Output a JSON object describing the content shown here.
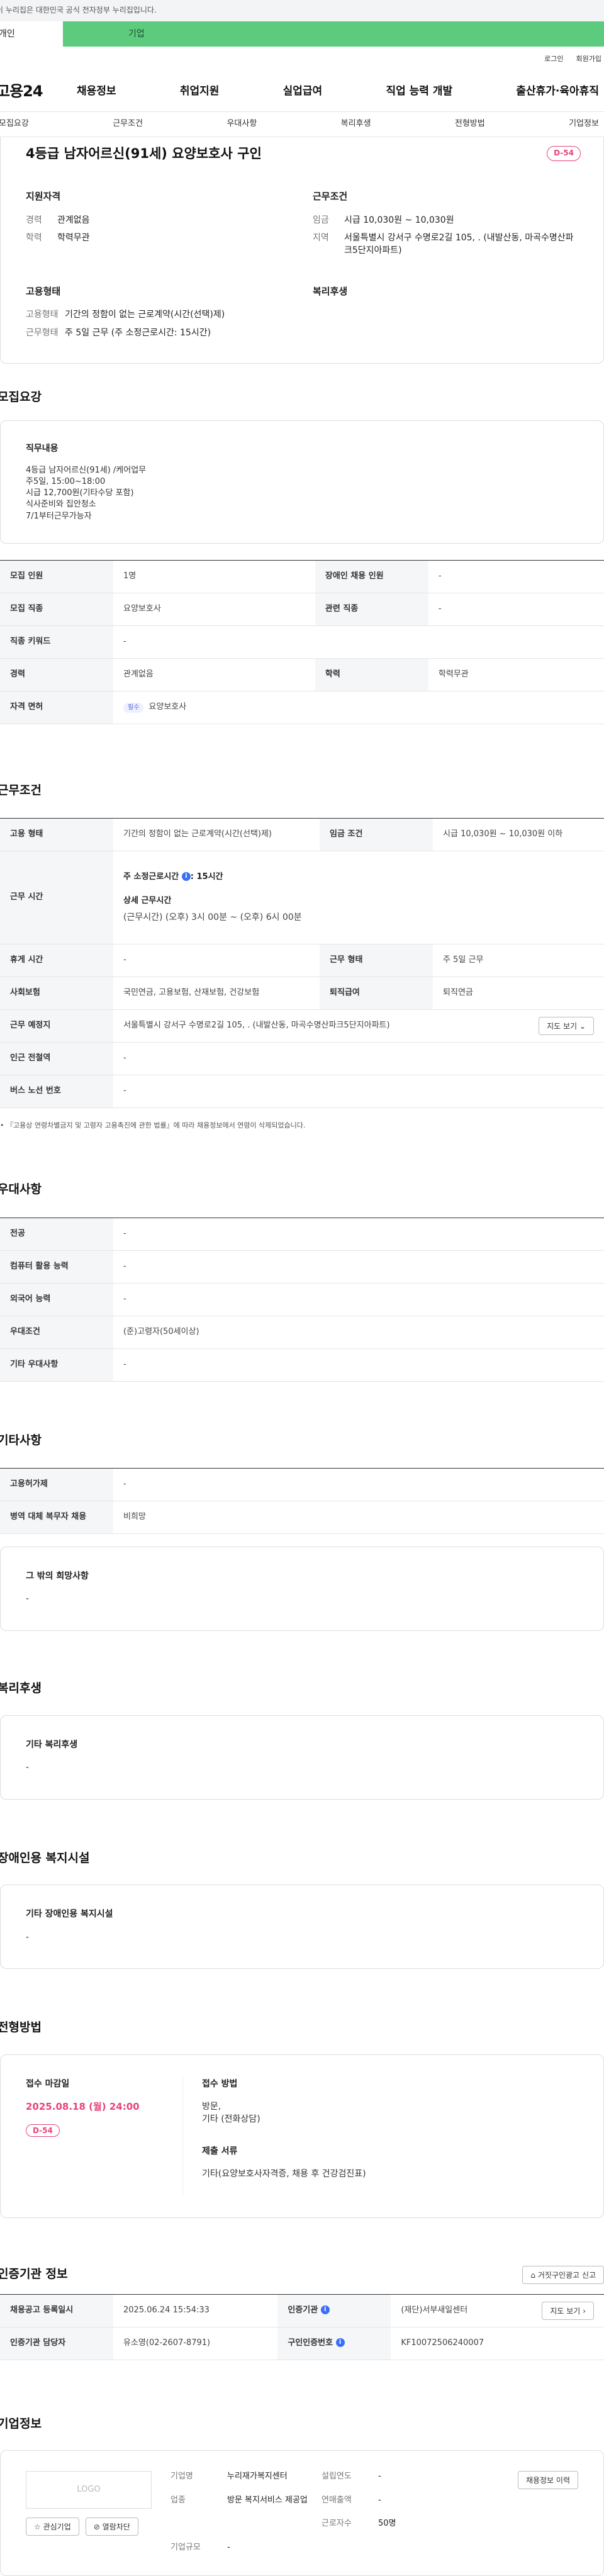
{
  "gov_banner": "이 누리집은 대한민국 공식 전자정부 누리집입니다.",
  "top_tabs": {
    "left": "개인",
    "right": "기업"
  },
  "util_links": [
    "로그인",
    "회원가입"
  ],
  "header": {
    "logo": "고용24",
    "menu": [
      "채용정보",
      "취업지원",
      "실업급여",
      "직업 능력 개발",
      "출산휴가·육아휴직"
    ]
  },
  "sub_nav": [
    "모집요강",
    "근무조건",
    "우대사항",
    "복리후생",
    "전형방법",
    "기업정보"
  ],
  "summary": {
    "title": "4등급 남자어르신(91세) 요양보호사 구인",
    "dday": "D-54",
    "qualification": {
      "heading": "지원자격",
      "rows": [
        {
          "k": "경력",
          "v": "관계없음"
        },
        {
          "k": "학력",
          "v": "학력무관"
        }
      ]
    },
    "conditions": {
      "heading": "근무조건",
      "rows": [
        {
          "k": "임금",
          "v": "시급 10,030원 ~ 10,030원"
        },
        {
          "k": "지역",
          "v": "서울특별시 강서구 수명로2길 105, . (내발산동, 마곡수명산파크5단지아파트)"
        }
      ]
    },
    "employment": {
      "heading": "고용형태",
      "rows": [
        {
          "k": "고용형태",
          "v": "기간의 정함이 없는 근로계약(시간(선택)제)"
        },
        {
          "k": "근무형태",
          "v": "주 5일 근무 (주 소정근로시간: 15시간)"
        }
      ]
    },
    "welfare_heading": "복리후생"
  },
  "recruit": {
    "title": "모집요강",
    "duty_label": "직무내용",
    "duty_lines": [
      "4등급 남자어르신(91세) /케어업무",
      "주5일, 15:00~18:00",
      "시급 12,700원(기타수당 포함)",
      "식사준비와 집안청소",
      "7/1부터근무가능자"
    ],
    "rows": [
      {
        "k1": "모집 인원",
        "v1": "1명",
        "k2": "장애인 채용 인원",
        "v2": "-"
      },
      {
        "k1": "모집 직종",
        "v1": "요양보호사",
        "k2": "관련 직종",
        "v2": "-"
      },
      {
        "k1": "직종 키워드",
        "v1": "-"
      },
      {
        "k1": "경력",
        "v1": "관계없음",
        "k2": "학력",
        "v2": "학력무관"
      }
    ],
    "license_label": "자격 면허",
    "license_chip": "필수",
    "license_value": "요양보호사"
  },
  "work": {
    "title": "근무조건",
    "emp_type_label": "고용 형태",
    "emp_type": "기간의 정함이 없는 근로계약(시간(선택)제)",
    "wage_label": "임금 조건",
    "wage": "시급 10,030원 ~ 10,030원 이하",
    "hours_label": "근무 시간",
    "weekly_hours": "주 소정근로시간 ",
    "weekly_hours_value": ": 15시간",
    "detail_label": "상세 근무시간",
    "detail": "(근무시간) (오후) 3시 00분 ~ (오후) 6시 00분",
    "rest_label": "휴게 시간",
    "rest": "-",
    "form_label": "근무 형태",
    "form": "주 5일 근무",
    "insurance_label": "사회보험",
    "insurance": "국민연금, 고용보험, 산재보험, 건강보험",
    "severance_label": "퇴직급여",
    "severance": "퇴직연금",
    "location_label": "근무 예정지",
    "location": "서울특별시 강서구 수명로2길 105, . (내발산동, 마곡수명산파크5단지아파트)",
    "map_button": "지도 보기",
    "subway_label": "인근 전철역",
    "subway": "-",
    "bus_label": "버스 노선 번호",
    "bus": "-",
    "footnote": "『고용상 연령차별금지 및 고령자 고용촉진에 관한 법률』에 따라 채용정보에서 연령이 삭제되었습니다."
  },
  "preference": {
    "title": "우대사항",
    "rows": [
      {
        "k": "전공",
        "v": "-"
      },
      {
        "k": "컴퓨터 활용 능력",
        "v": "-"
      },
      {
        "k": "외국어 능력",
        "v": "-"
      },
      {
        "k": "우대조건",
        "v": "(준)고령자(50세이상)"
      },
      {
        "k": "기타 우대사항",
        "v": "-"
      }
    ]
  },
  "other": {
    "title": "기타사항",
    "rows": [
      {
        "k": "고용허가제",
        "v": "-"
      },
      {
        "k": "병역 대체 복무자 채용",
        "v": "비희망"
      }
    ],
    "etc_label": "그 밖의 희망사항",
    "etc_value": "-"
  },
  "welfare": {
    "title": "복리후생",
    "label": "기타 복리후생",
    "value": "-"
  },
  "disability": {
    "title": "장애인용 복지시설",
    "label": "기타 장애인용 복지시설",
    "value": "-"
  },
  "process": {
    "title": "전형방법",
    "deadline_label": "접수 마감일",
    "deadline": "2025.08.18 (월) 24:00",
    "dday": "D-54",
    "method_label": "접수 방법",
    "method_lines": [
      "방문,",
      "기타 (전화상담)"
    ],
    "docs_label": "제출 서류",
    "docs": "기타(요양보호사자격증, 채용 후 건강검진표)"
  },
  "cert": {
    "title": "인증기관 정보",
    "report_button": "거짓구인광고 신고",
    "reg_label": "채용공고 등록일시",
    "reg": "2025.06.24 15:54:33",
    "agency_label": "인증기관",
    "agency": "(재단)서부새일센터",
    "map_button": "지도 보기",
    "manager_label": "인증기관 담당자",
    "manager": "유소영(02-2607-8791)",
    "cert_no_label": "구인인증번호",
    "cert_no": "KF10072506240007"
  },
  "company": {
    "title": "기업정보",
    "logo_text": "LOGO",
    "interest_button": "관심기업",
    "block_button": "열람차단",
    "name_label": "기업명",
    "name": "누리재가복지센터",
    "year_label": "설립연도",
    "year": "-",
    "industry_label": "업종",
    "industry": "방문 복지서비스 제공업",
    "revenue_label": "연매출액",
    "revenue": "-",
    "staff_label": "근로자수",
    "staff": "50명",
    "size_label": "기업규모",
    "size": "-",
    "history_button": "채용정보 이력"
  }
}
